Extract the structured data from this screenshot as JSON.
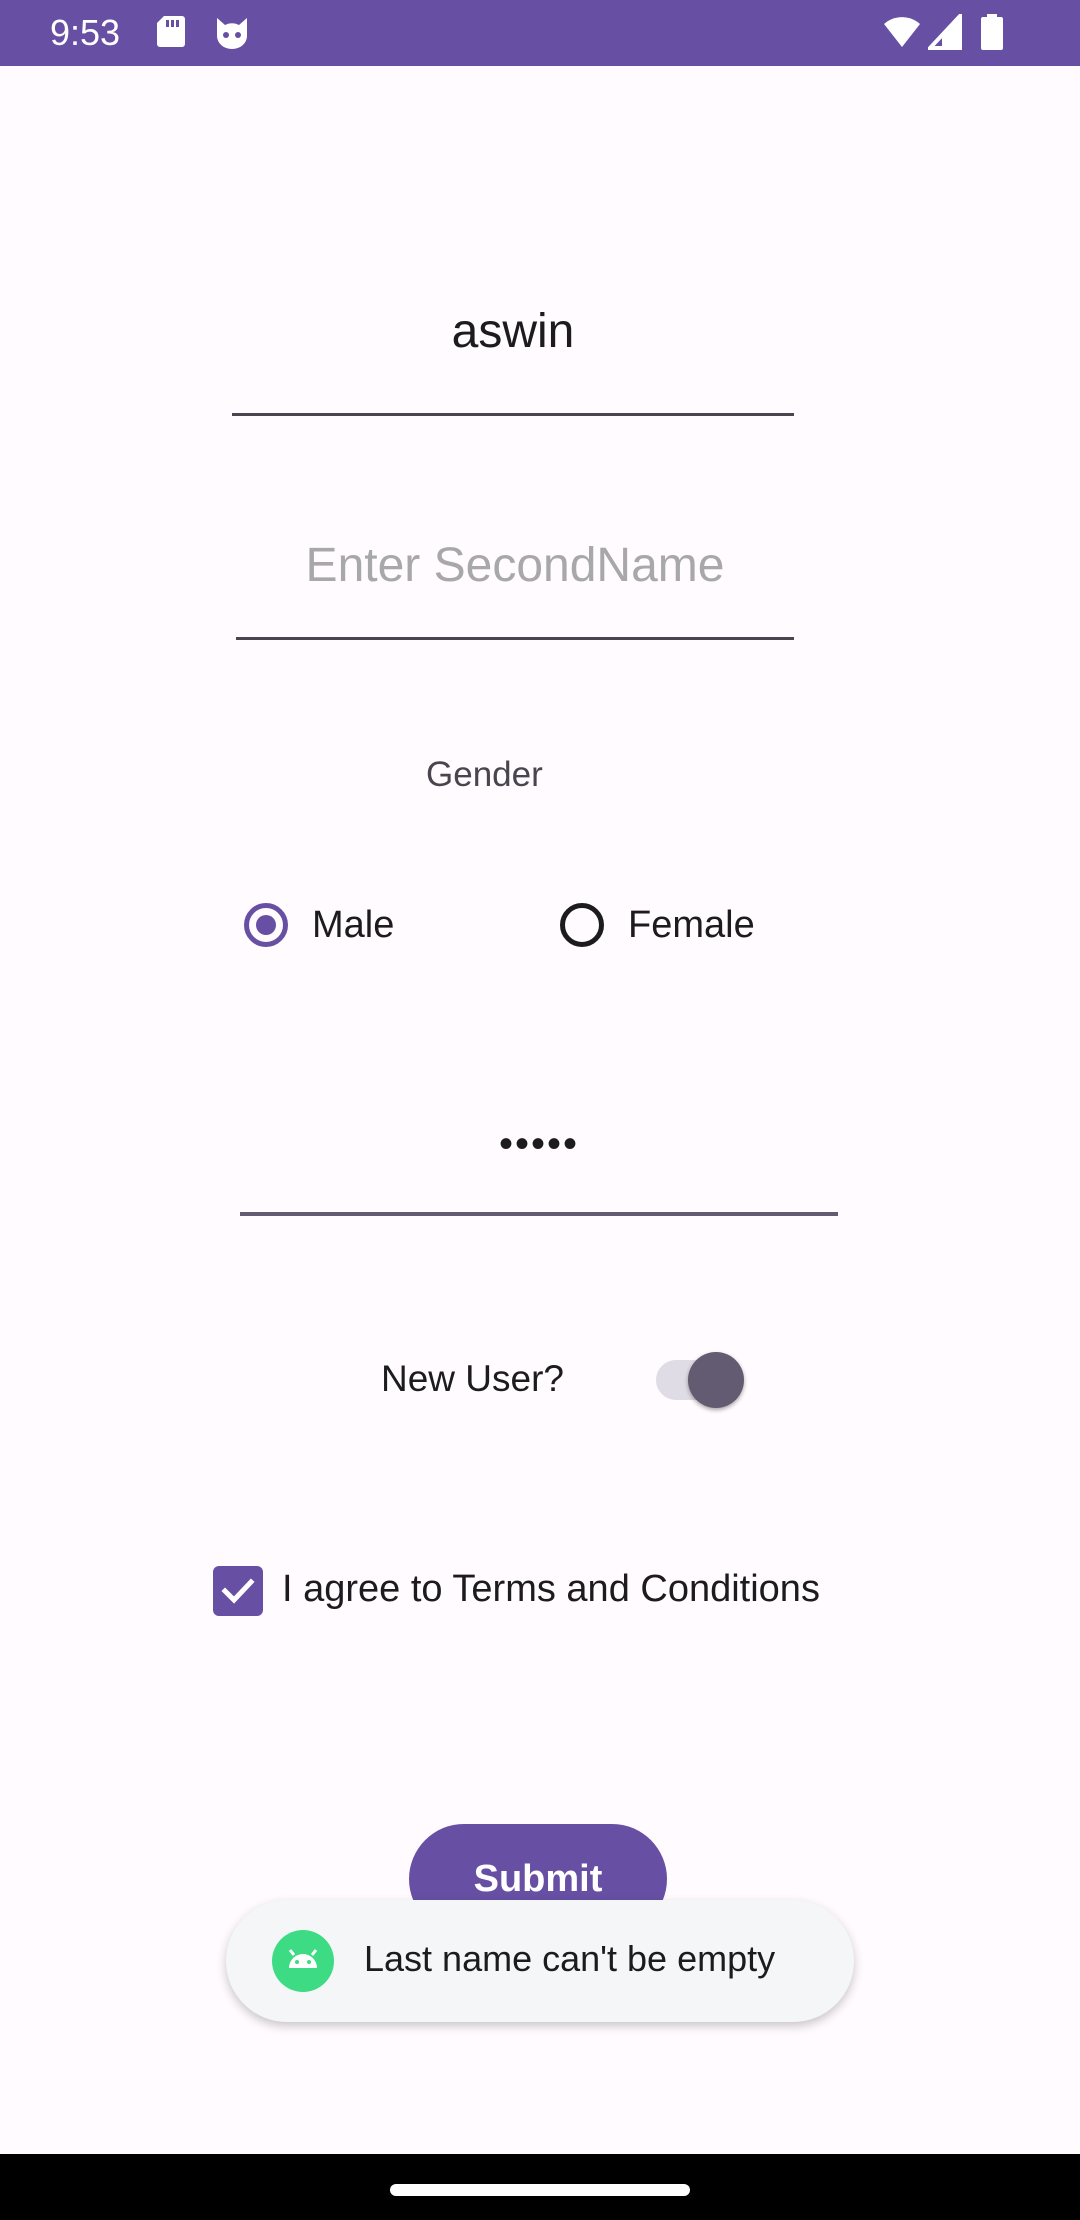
{
  "status_bar": {
    "time": "9:53",
    "icons": [
      "sd-card-icon",
      "cat-icon",
      "wifi-icon",
      "signal-icon",
      "battery-icon"
    ],
    "background": "#6750A4"
  },
  "form": {
    "first_name": {
      "value": "aswin",
      "placeholder": ""
    },
    "second_name": {
      "value": "",
      "placeholder": "Enter SecondName"
    },
    "gender_label": "Gender",
    "gender_options": [
      {
        "label": "Male",
        "selected": true
      },
      {
        "label": "Female",
        "selected": false
      }
    ],
    "password_mask": "•••••",
    "new_user_label": "New User?",
    "new_user_switch_on": true,
    "terms_label": "I agree to Terms and Conditions",
    "terms_checked": true,
    "submit_label": "Submit"
  },
  "toast": {
    "message": "Last name can't be empty",
    "icon": "android-icon"
  },
  "colors": {
    "primary": "#6750A4",
    "background": "#FFFBFE",
    "on_surface": "#1C1B1F",
    "placeholder": "#A8A8A8"
  }
}
